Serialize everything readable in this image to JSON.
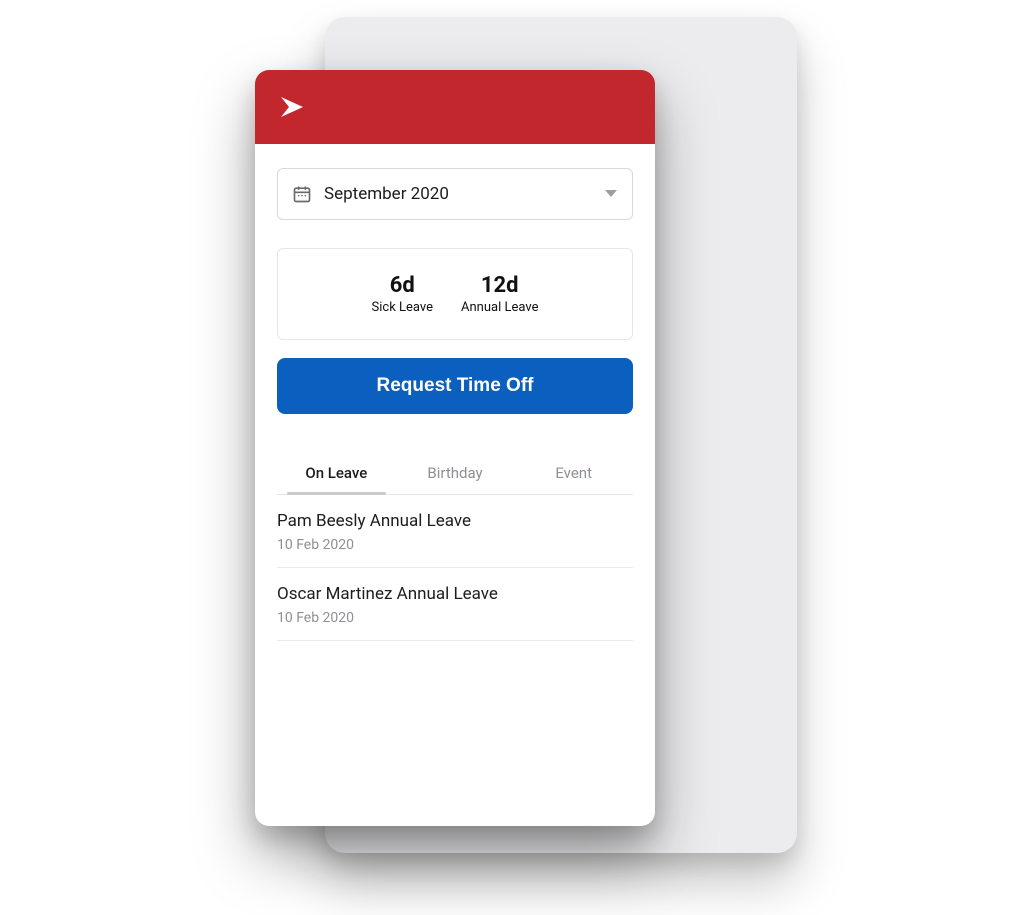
{
  "colors": {
    "brand_red": "#c3272e",
    "primary_blue": "#0b5fbf"
  },
  "month_picker": {
    "label": "September 2020"
  },
  "balances": {
    "sick": {
      "value": "6d",
      "label": "Sick Leave"
    },
    "annual": {
      "value": "12d",
      "label": "Annual Leave"
    }
  },
  "actions": {
    "request_time_off": "Request Time Off"
  },
  "tabs": {
    "on_leave": "On Leave",
    "birthday": "Birthday",
    "event": "Event",
    "active": "on_leave"
  },
  "on_leave_list": [
    {
      "title": "Pam Beesly Annual Leave",
      "date": "10 Feb 2020"
    },
    {
      "title": "Oscar Martinez Annual Leave",
      "date": "10 Feb 2020"
    }
  ]
}
